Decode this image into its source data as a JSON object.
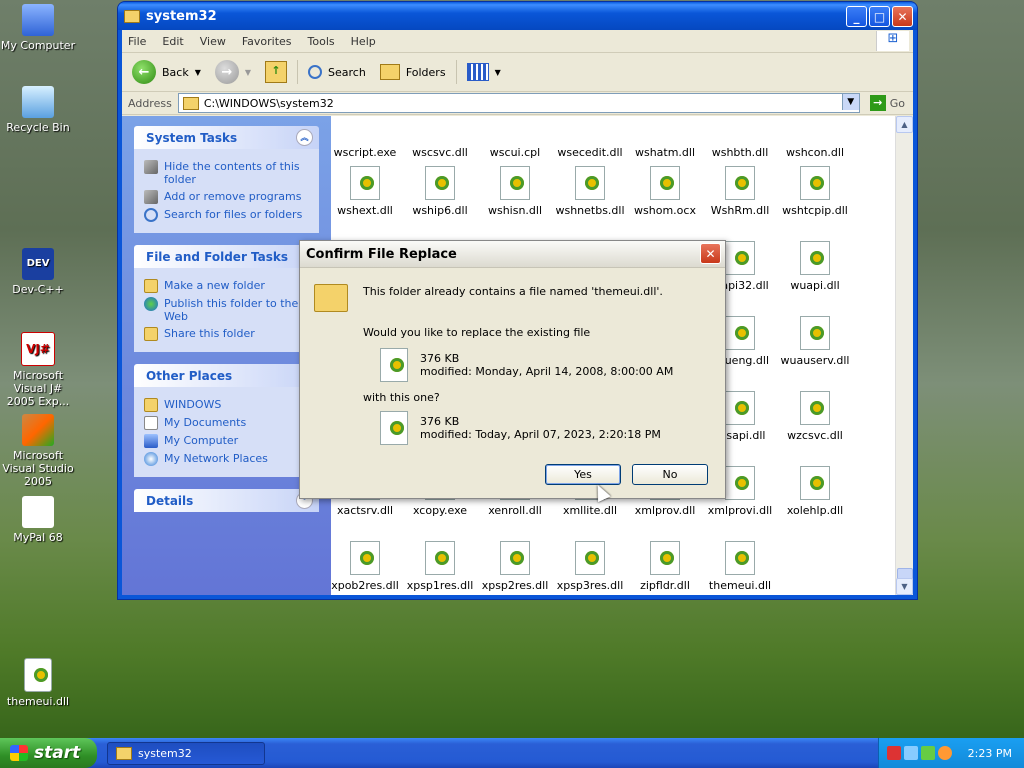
{
  "desktop": {
    "icons": [
      {
        "label": "My Computer",
        "icon": "my-computer-icon"
      },
      {
        "label": "Recycle Bin",
        "icon": "recycle-bin-icon"
      },
      {
        "label": "Dev-C++",
        "icon": "dev-cpp-icon",
        "glyph": "DEV"
      },
      {
        "label": "Microsoft Visual J# 2005 Exp...",
        "icon": "visual-jsharp-icon",
        "glyph": "VJ#"
      },
      {
        "label": "Microsoft Visual Studio 2005",
        "icon": "visual-studio-icon"
      },
      {
        "label": "MyPal 68",
        "icon": "mypal-icon"
      },
      {
        "label": "themeui.dll",
        "icon": "dll-file-icon"
      }
    ]
  },
  "window": {
    "title": "system32",
    "controls": {
      "minimize": "_",
      "maximize": "□",
      "close": "✕"
    },
    "menu": [
      "File",
      "Edit",
      "View",
      "Favorites",
      "Tools",
      "Help"
    ],
    "toolbar": {
      "back": "Back",
      "search": "Search",
      "folders": "Folders"
    },
    "address": {
      "label": "Address",
      "value": "C:\\WINDOWS\\system32",
      "go": "Go"
    }
  },
  "taskpane": {
    "system_tasks": {
      "title": "System Tasks",
      "items": [
        "Hide the contents of this folder",
        "Add or remove programs",
        "Search for files or folders"
      ]
    },
    "file_folder_tasks": {
      "title": "File and Folder Tasks",
      "items": [
        "Make a new folder",
        "Publish this folder to the Web",
        "Share this folder"
      ]
    },
    "other_places": {
      "title": "Other Places",
      "items": [
        "WINDOWS",
        "My Documents",
        "My Computer",
        "My Network Places"
      ]
    },
    "details": {
      "title": "Details"
    }
  },
  "files": {
    "row1": [
      "wscript.exe",
      "wscsvc.dll",
      "wscui.cpl",
      "wsecedit.dll",
      "wshatm.dll",
      "wshbth.dll",
      "wshcon.dll"
    ],
    "row2": [
      "wshext.dll",
      "wship6.dll",
      "wshisn.dll",
      "wshnetbs.dll",
      "wshom.ocx",
      "WshRm.dll",
      "wshtcpip.dll"
    ],
    "row3": [
      "tsapi32.dll",
      "wuapi.dll"
    ],
    "row4": [
      "uaueng.dll",
      "wuauserv.dll"
    ],
    "row5": [
      "zcsapi.dll",
      "wzcsvc.dll"
    ],
    "row6": [
      "xactsrv.dll",
      "xcopy.exe",
      "xenroll.dll",
      "xmllite.dll",
      "xmlprov.dll",
      "xmlprovi.dll",
      "xolehlp.dll"
    ],
    "row7": [
      "xpob2res.dll",
      "xpsp1res.dll",
      "xpsp2res.dll",
      "xpsp3res.dll",
      "zipfldr.dll",
      "themeui.dll"
    ]
  },
  "dialog": {
    "title": "Confirm File Replace",
    "message": "This folder already contains a file named 'themeui.dll'.",
    "question": "Would you like to replace the existing file",
    "existing": {
      "size": "376 KB",
      "modified": "modified: Monday, April 14, 2008, 8:00:00 AM"
    },
    "with_label": "with this one?",
    "new": {
      "size": "376 KB",
      "modified": "modified: Today, April 07, 2023, 2:20:18 PM"
    },
    "yes": "Yes",
    "no": "No"
  },
  "taskbar": {
    "start": "start",
    "task": "system32",
    "clock": "2:23 PM"
  }
}
